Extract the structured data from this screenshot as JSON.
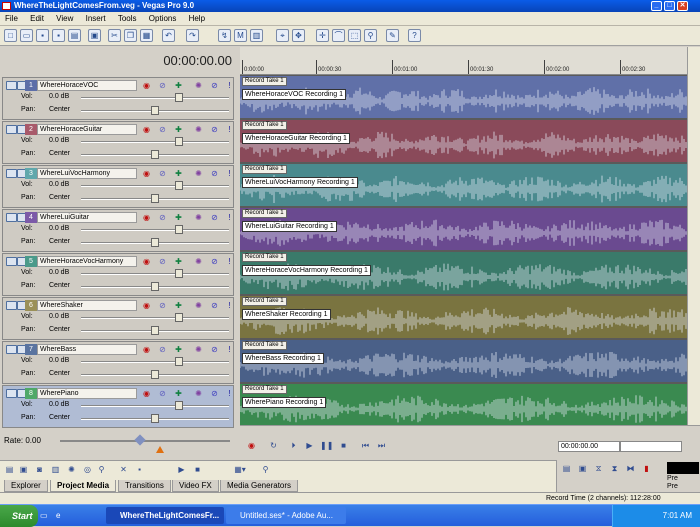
{
  "window": {
    "title": "WhereTheLightComesFrom.veg - Vegas Pro 9.0"
  },
  "menu": [
    "File",
    "Edit",
    "View",
    "Insert",
    "Tools",
    "Options",
    "Help"
  ],
  "timecode": "00:00:00.00",
  "ruler": [
    "0:00:00",
    "00:00:30",
    "00:01:00",
    "00:01:30",
    "00:02:00",
    "00:02:30"
  ],
  "tracks": [
    {
      "num": "1",
      "name": "WhereHoraceVOC",
      "vol": "0.0 dB",
      "pan": "Center",
      "event_header": "Record Take 1",
      "event_name": "WhereHoraceVOC Recording 1",
      "color": "#6070a8",
      "num_color": "#5c6ea8"
    },
    {
      "num": "2",
      "name": "WhereHoraceGuitar",
      "vol": "0.0 dB",
      "pan": "Center",
      "event_header": "Record Take 1",
      "event_name": "WhereHoraceGuitar Recording 1",
      "color": "#8a4a5a",
      "num_color": "#a85a6a"
    },
    {
      "num": "3",
      "name": "WhereLuiVocHarmony",
      "vol": "0.0 dB",
      "pan": "Center",
      "event_header": "Record Take 1",
      "event_name": "WhereLuiVocHarmony Recording 1",
      "color": "#4a8a8e",
      "num_color": "#60a8ac"
    },
    {
      "num": "4",
      "name": "WhereLuiGuitar",
      "vol": "0.0 dB",
      "pan": "Center",
      "event_header": "Record Take 1",
      "event_name": "WhereLuiGuitar Recording 1",
      "color": "#6a4a90",
      "num_color": "#7c5aa8"
    },
    {
      "num": "5",
      "name": "WhereHoraceVocHarmony",
      "vol": "0.0 dB",
      "pan": "Center",
      "event_header": "Record Take 1",
      "event_name": "WhereHoraceVocHarmony Recording 1",
      "color": "#3a7a6a",
      "num_color": "#4a9a8a"
    },
    {
      "num": "6",
      "name": "WhereShaker",
      "vol": "0.0 dB",
      "pan": "Center",
      "event_header": "Record Take 1",
      "event_name": "WhereShaker Recording 1",
      "color": "#7a7440",
      "num_color": "#9a9058"
    },
    {
      "num": "7",
      "name": "WhereBass",
      "vol": "0.0 dB",
      "pan": "Center",
      "event_header": "Record Take 1",
      "event_name": "WhereBass Recording 1",
      "color": "#4a6088",
      "num_color": "#5a74a0"
    },
    {
      "num": "8",
      "name": "WherePiano",
      "vol": "0.0 dB",
      "pan": "Center",
      "event_header": "Record Take 1",
      "event_name": "WherePiano Recording 1",
      "color": "#3a8a50",
      "num_color": "#50a868"
    }
  ],
  "labels": {
    "vol": "Vol:",
    "pan": "Pan:"
  },
  "rate": "Rate: 0.00",
  "transport_tc": "00:00:00.00",
  "tabs": [
    "Explorer",
    "Project Media",
    "Transitions",
    "Video FX",
    "Media Generators"
  ],
  "mixer": {
    "pre1": "Pre",
    "pre2": "Pre"
  },
  "status": "Record Time (2 channels): 112:28:00",
  "taskbar": {
    "start": "Start",
    "task1": "WhereTheLightComesFr...",
    "task2": "Untitled.ses* - Adobe Au...",
    "time": "7:01 AM"
  }
}
